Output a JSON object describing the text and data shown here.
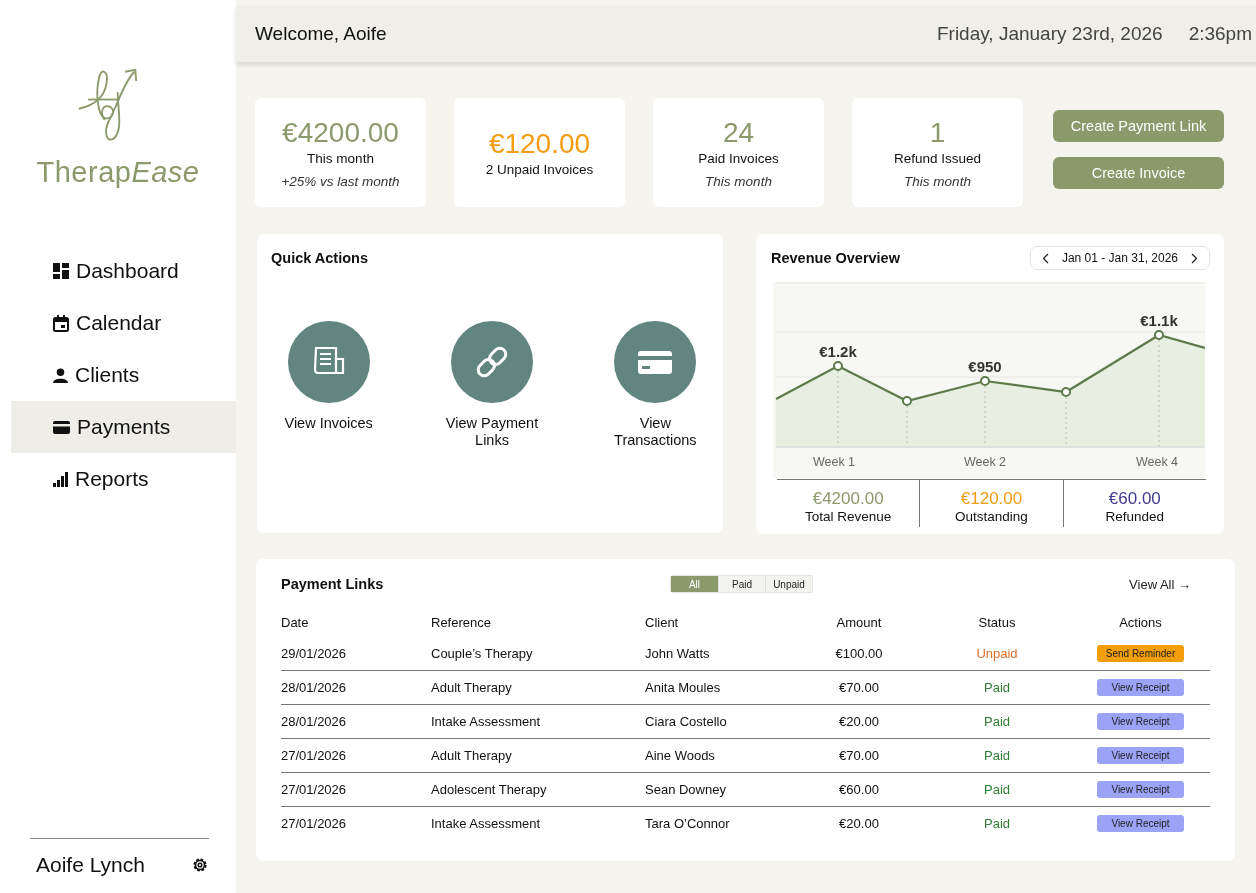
{
  "sidebar": {
    "logo_text": "Therap",
    "logo_text_italic": "Ease",
    "items": [
      {
        "label": "Dashboard",
        "selected": false
      },
      {
        "label": "Calendar",
        "selected": false
      },
      {
        "label": "Clients",
        "selected": false
      },
      {
        "label": "Payments",
        "selected": true
      },
      {
        "label": "Reports",
        "selected": false
      }
    ],
    "user": "Aoife Lynch"
  },
  "header": {
    "welcome": "Welcome, Aoife",
    "date": "Friday, January 23rd, 2026",
    "time": "2:36pm"
  },
  "stats": [
    {
      "value": "€4200.00",
      "label": "This month",
      "note": "+25% vs last month",
      "color": "#8a9a6b"
    },
    {
      "value": "€120.00",
      "label": "2 Unpaid Invoices",
      "color": "#f39c12"
    },
    {
      "value": "24",
      "label": "Paid Invoices",
      "note": "This month",
      "color": "#8a9a6b"
    },
    {
      "value": "1",
      "label": "Refund Issued",
      "note": "This month",
      "color": "#8a9a6b"
    }
  ],
  "buttons": [
    "Create Payment Link",
    "Create Invoice"
  ],
  "quick_actions": {
    "title": "Quick Actions",
    "items": [
      {
        "label": "View Invoices"
      },
      {
        "label": "View Payment Links"
      },
      {
        "label": "View Transactions"
      }
    ]
  },
  "revenue": {
    "title": "Revenue Overview",
    "range": "Jan 01 - Jan 31, 2026",
    "chart": {
      "point_labels": [
        "€1.2k",
        "€950",
        "€1.1k"
      ],
      "week_labels": [
        "Week 1",
        "Week 2",
        "Week 4"
      ]
    },
    "totals": [
      {
        "value": "€4200.00",
        "label": "Total Revenue",
        "color": "#8a9a6b"
      },
      {
        "value": "€120.00",
        "label": "Outstanding",
        "color": "#f39c12"
      },
      {
        "value": "€60.00",
        "label": "Refunded",
        "color": "#3f3b8f"
      }
    ]
  },
  "payment_links": {
    "title": "Payment Links",
    "filters": [
      {
        "label": "All",
        "selected": true
      },
      {
        "label": "Paid",
        "selected": false
      },
      {
        "label": "Unpaid",
        "selected": false
      }
    ],
    "view_all": "View All →",
    "columns": [
      "Date",
      "Reference",
      "Client",
      "Amount",
      "Status",
      "Actions"
    ],
    "rows": [
      {
        "date": "29/01/2026",
        "reference": "Couple’s Therapy",
        "client": "John Watts",
        "amount": "€100.00",
        "status": "Unpaid",
        "kind": "unpaid",
        "action": "Send Reminder"
      },
      {
        "date": "28/01/2026",
        "reference": "Adult Therapy",
        "client": "Anita Moules",
        "amount": "€70.00",
        "status": "Paid",
        "kind": "paid",
        "action": "View Receipt"
      },
      {
        "date": "28/01/2026",
        "reference": "Intake Assessment",
        "client": "Ciara Costello",
        "amount": "€20.00",
        "status": "Paid",
        "kind": "paid",
        "action": "View Receipt"
      },
      {
        "date": "27/01/2026",
        "reference": "Adult Therapy",
        "client": "Aine Woods",
        "amount": "€70.00",
        "status": "Paid",
        "kind": "paid",
        "action": "View Receipt"
      },
      {
        "date": "27/01/2026",
        "reference": "Adolescent Therapy",
        "client": "Sean Downey",
        "amount": "€60.00",
        "status": "Paid",
        "kind": "paid",
        "action": "View Receipt"
      },
      {
        "date": "27/01/2026",
        "reference": "Intake Assessment",
        "client": "Tara O’Connor",
        "amount": "€20.00",
        "status": "Paid",
        "kind": "paid",
        "action": "View Receipt"
      }
    ]
  }
}
